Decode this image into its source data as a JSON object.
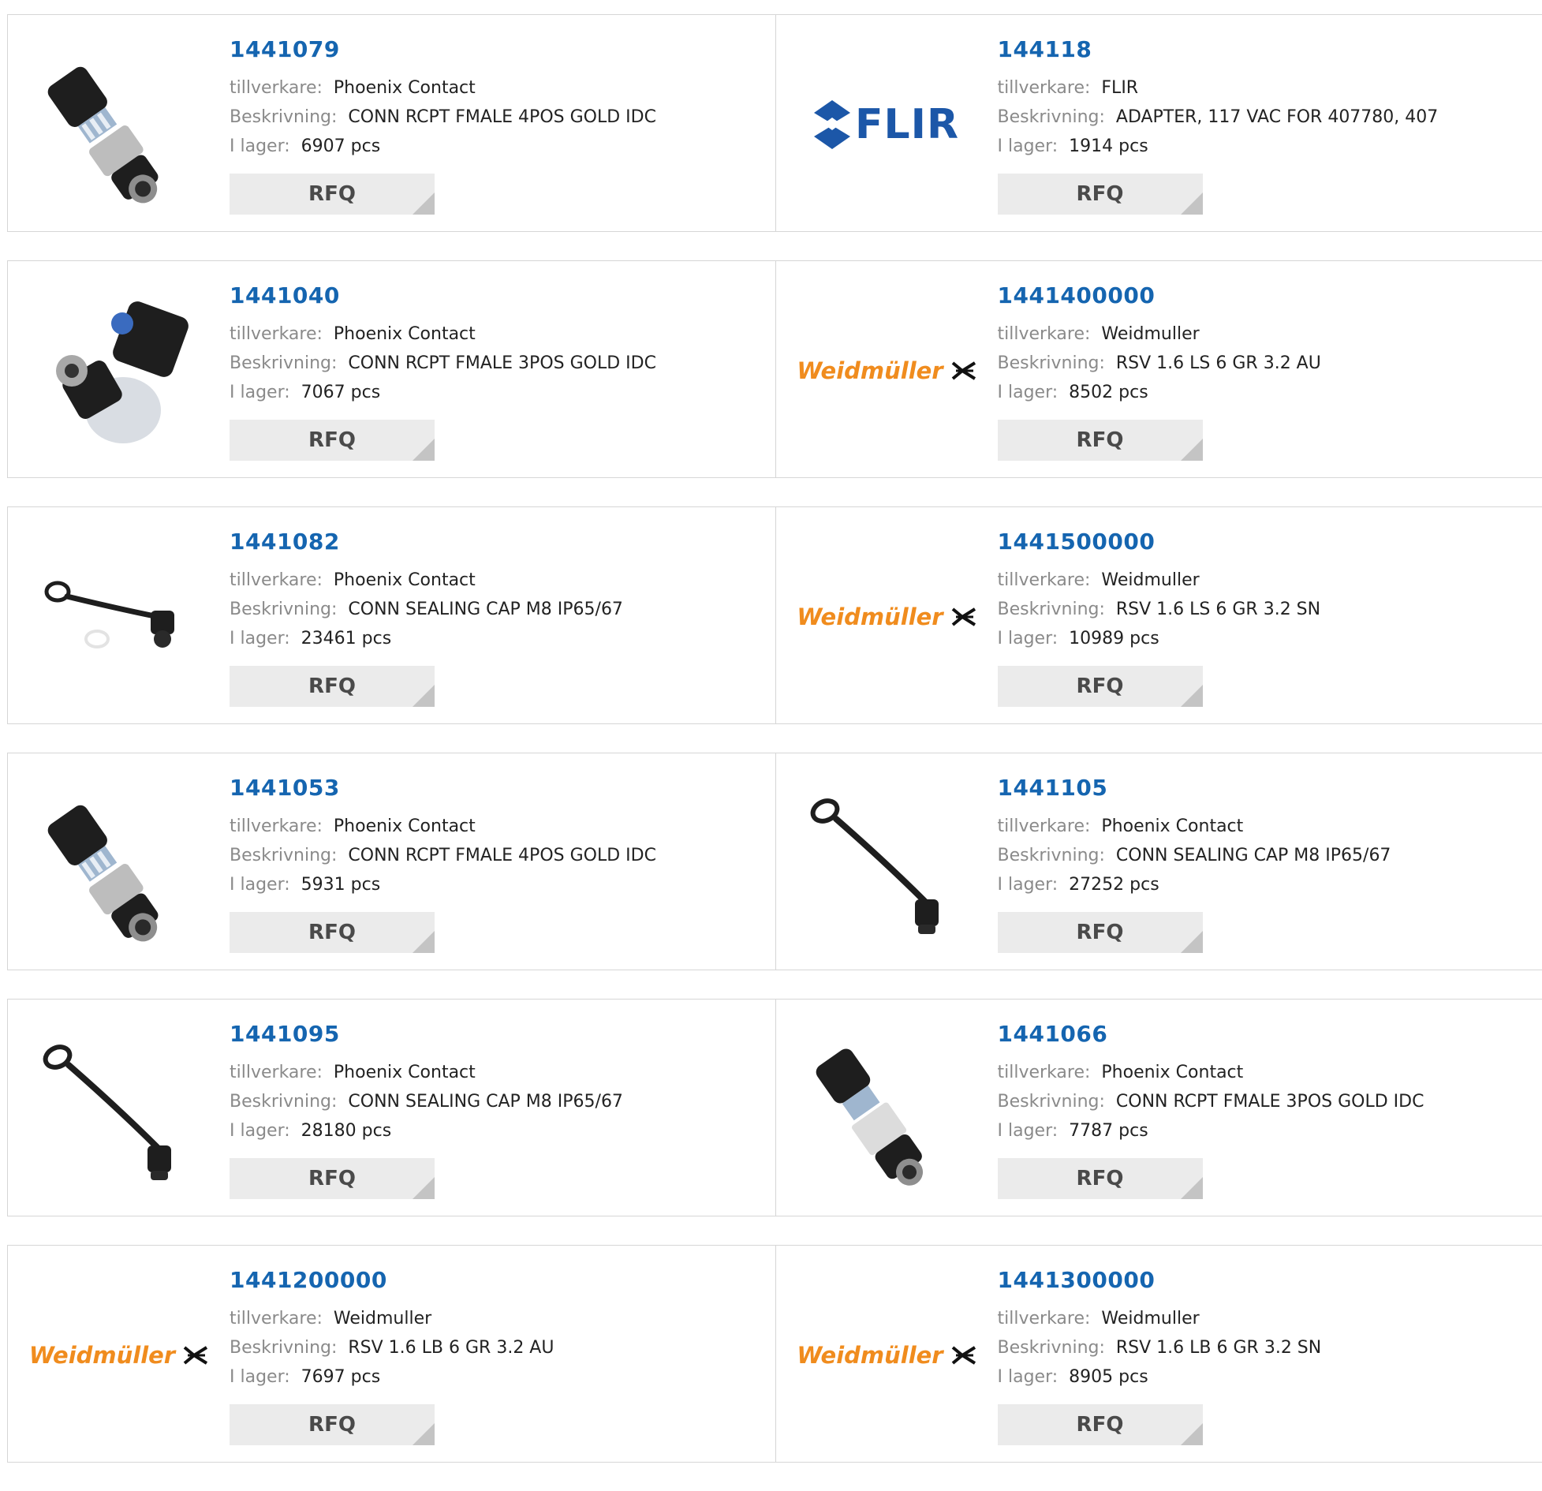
{
  "labels": {
    "manufacturer": "tillverkare:",
    "description": "Beskrivning:",
    "stock": "I lager:",
    "rfq": "RFQ"
  },
  "rows": [
    {
      "left": {
        "pn": "1441079",
        "mfr": "Phoenix Contact",
        "desc": "CONN RCPT FMALE 4POS GOLD IDC",
        "stock": "6907 pcs",
        "image": "connector-4pos"
      },
      "right": {
        "pn": "144118",
        "mfr": "FLIR",
        "desc": "ADAPTER, 117 VAC FOR 407780, 407",
        "stock": "1914 pcs",
        "image": "flir-logo",
        "logo_text": "FLIR"
      }
    },
    {
      "left": {
        "pn": "1441040",
        "mfr": "Phoenix Contact",
        "desc": "CONN RCPT FMALE 3POS GOLD IDC",
        "stock": "7067 pcs",
        "image": "connector-3pos"
      },
      "right": {
        "pn": "1441400000",
        "mfr": "Weidmuller",
        "desc": "RSV 1.6 LS 6 GR 3.2 AU",
        "stock": "8502 pcs",
        "image": "weidmuller-logo",
        "logo_text": "Weidmüller"
      }
    },
    {
      "left": {
        "pn": "1441082",
        "mfr": "Phoenix Contact",
        "desc": "CONN SEALING CAP M8 IP65/67",
        "stock": "23461 pcs",
        "image": "sealing-cap-flat"
      },
      "right": {
        "pn": "1441500000",
        "mfr": "Weidmuller",
        "desc": "RSV 1.6 LS 6 GR 3.2 SN",
        "stock": "10989 pcs",
        "image": "weidmuller-logo",
        "logo_text": "Weidmüller"
      }
    },
    {
      "left": {
        "pn": "1441053",
        "mfr": "Phoenix Contact",
        "desc": "CONN RCPT FMALE 4POS GOLD IDC",
        "stock": "5931 pcs",
        "image": "connector-4pos"
      },
      "right": {
        "pn": "1441105",
        "mfr": "Phoenix Contact",
        "desc": "CONN SEALING CAP M8 IP65/67",
        "stock": "27252 pcs",
        "image": "sealing-cap"
      }
    },
    {
      "left": {
        "pn": "1441095",
        "mfr": "Phoenix Contact",
        "desc": "CONN SEALING CAP M8 IP65/67",
        "stock": "28180 pcs",
        "image": "sealing-cap"
      },
      "right": {
        "pn": "1441066",
        "mfr": "Phoenix Contact",
        "desc": "CONN RCPT FMALE 3POS GOLD IDC",
        "stock": "7787 pcs",
        "image": "connector-3pos-b"
      }
    },
    {
      "left": {
        "pn": "1441200000",
        "mfr": "Weidmuller",
        "desc": "RSV 1.6 LB 6 GR 3.2 AU",
        "stock": "7697 pcs",
        "image": "weidmuller-logo",
        "logo_text": "Weidmüller"
      },
      "right": {
        "pn": "1441300000",
        "mfr": "Weidmuller",
        "desc": "RSV 1.6 LB 6 GR 3.2 SN",
        "stock": "8905 pcs",
        "image": "weidmuller-logo",
        "logo_text": "Weidmüller"
      }
    }
  ],
  "colors": {
    "link": "#1565b0",
    "label": "#8a8a8a",
    "rfq_bg": "#ebebeb",
    "border": "#d6d6d6",
    "flir": "#1c57a8",
    "weidmuller": "#f08c1e"
  }
}
